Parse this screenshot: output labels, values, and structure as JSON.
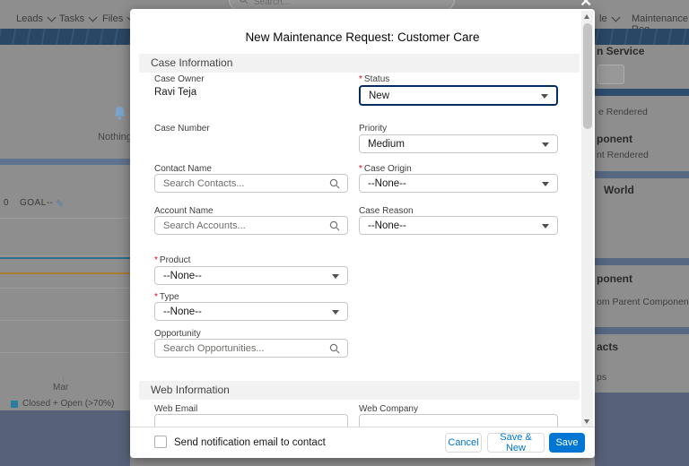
{
  "colors": {
    "accent": "#0176d3",
    "required_marker_color": "#ea001e",
    "save_button_bg": "#0176d3",
    "banner_navy": "#2a4766"
  },
  "icons": {
    "close": "✕",
    "pencil": "✎"
  },
  "header": {
    "search_placeholder": "Search..."
  },
  "nav": {
    "left": [
      "Leads",
      "Tasks",
      "Files"
    ],
    "right": [
      "le",
      "Maintenance Req"
    ]
  },
  "background": {
    "assistant_text": "Nothing ne",
    "goal": {
      "prefix": "0",
      "label": "GOAL",
      "value": "--"
    },
    "chart": {
      "x_tick": "Mar",
      "legend": "Closed + Open (>70%)"
    },
    "right_fragments": [
      "n Service",
      "e Rendered",
      "ponent",
      "nt Rendered",
      "World",
      "ponent",
      "om Parent Component!!",
      "acts",
      "ps"
    ]
  },
  "modal": {
    "title": "New Maintenance Request: Customer Care",
    "required_marker": "*",
    "section1": "Case Information",
    "section2": "Web Information",
    "fields": {
      "case_owner": {
        "label": "Case Owner",
        "value": "Ravi Teja"
      },
      "status": {
        "label": "Status",
        "value": "New"
      },
      "case_number": {
        "label": "Case Number"
      },
      "priority": {
        "label": "Priority",
        "value": "Medium"
      },
      "contact_name": {
        "label": "Contact Name",
        "placeholder": "Search Contacts..."
      },
      "case_origin": {
        "label": "Case Origin",
        "value": "--None--"
      },
      "account_name": {
        "label": "Account Name",
        "placeholder": "Search Accounts..."
      },
      "case_reason": {
        "label": "Case Reason",
        "value": "--None--"
      },
      "product": {
        "label": "Product",
        "value": "--None--"
      },
      "type": {
        "label": "Type",
        "value": "--None--"
      },
      "opportunity": {
        "label": "Opportunity",
        "placeholder": "Search Opportunities..."
      },
      "web_email": {
        "label": "Web Email"
      },
      "web_company": {
        "label": "Web Company"
      }
    },
    "footer": {
      "checkbox_label": "Send notification email to contact",
      "cancel": "Cancel",
      "save_and_new": "Save & New",
      "save": "Save"
    }
  }
}
